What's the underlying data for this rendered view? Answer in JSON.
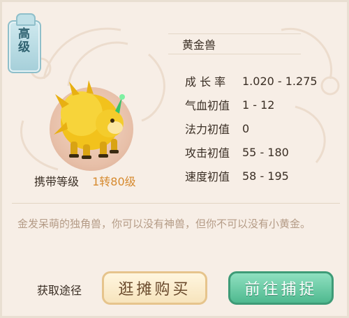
{
  "tier_badge": {
    "text": "高级"
  },
  "pet": {
    "name": "黄金兽",
    "carry_level_label": "携带等级",
    "carry_level_value": "1转80级"
  },
  "attributes": [
    {
      "label": "成 长 率",
      "value": "1.020 - 1.275"
    },
    {
      "label": "气血初值",
      "value": "1 - 12"
    },
    {
      "label": "法力初值",
      "value": "0"
    },
    {
      "label": "攻击初值",
      "value": "55 - 180"
    },
    {
      "label": "速度初值",
      "value": "58 - 195"
    }
  ],
  "description": "金发呆萌的独角兽，你可以没有神兽，但你不可以没有小黄金。",
  "obtain": {
    "label": "获取途径",
    "market_button": "逛摊购买",
    "capture_button": "前往捕捉"
  },
  "colors": {
    "panel_bg": "#f7eee6",
    "level_value": "#d68a2f",
    "description_text": "#b49b86",
    "capture_button": "#4fb98f",
    "market_button": "#f7e4bd"
  }
}
